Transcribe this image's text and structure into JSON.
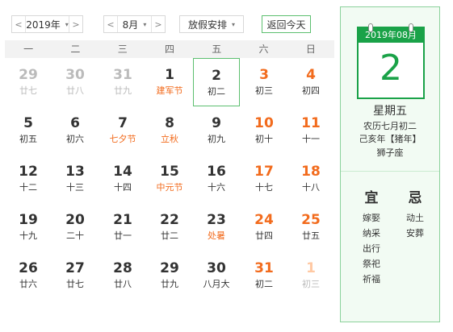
{
  "toolbar": {
    "year": "2019年",
    "month": "8月",
    "holiday": "放假安排",
    "today_button": "返回今天",
    "prev_symbol": "<",
    "next_symbol": ">",
    "dropdown_symbol": "▾"
  },
  "weekdays": [
    "一",
    "二",
    "三",
    "四",
    "五",
    "六",
    "日"
  ],
  "weeks": [
    [
      {
        "day": "29",
        "lunar": "廿七",
        "other": true
      },
      {
        "day": "30",
        "lunar": "廿八",
        "other": true
      },
      {
        "day": "31",
        "lunar": "廿九",
        "other": true
      },
      {
        "day": "1",
        "lunar": "建军节",
        "festival": true
      },
      {
        "day": "2",
        "lunar": "初二",
        "selected": true
      },
      {
        "day": "3",
        "lunar": "初三"
      },
      {
        "day": "4",
        "lunar": "初四"
      }
    ],
    [
      {
        "day": "5",
        "lunar": "初五"
      },
      {
        "day": "6",
        "lunar": "初六"
      },
      {
        "day": "7",
        "lunar": "七夕节",
        "festival": true
      },
      {
        "day": "8",
        "lunar": "立秋",
        "festival": true
      },
      {
        "day": "9",
        "lunar": "初九"
      },
      {
        "day": "10",
        "lunar": "初十"
      },
      {
        "day": "11",
        "lunar": "十一"
      }
    ],
    [
      {
        "day": "12",
        "lunar": "十二"
      },
      {
        "day": "13",
        "lunar": "十三"
      },
      {
        "day": "14",
        "lunar": "十四"
      },
      {
        "day": "15",
        "lunar": "中元节",
        "festival": true
      },
      {
        "day": "16",
        "lunar": "十六"
      },
      {
        "day": "17",
        "lunar": "十七"
      },
      {
        "day": "18",
        "lunar": "十八"
      }
    ],
    [
      {
        "day": "19",
        "lunar": "十九"
      },
      {
        "day": "20",
        "lunar": "二十"
      },
      {
        "day": "21",
        "lunar": "廿一"
      },
      {
        "day": "22",
        "lunar": "廿二"
      },
      {
        "day": "23",
        "lunar": "处暑",
        "festival": true
      },
      {
        "day": "24",
        "lunar": "廿四"
      },
      {
        "day": "25",
        "lunar": "廿五"
      }
    ],
    [
      {
        "day": "26",
        "lunar": "廿六"
      },
      {
        "day": "27",
        "lunar": "廿七"
      },
      {
        "day": "28",
        "lunar": "廿八"
      },
      {
        "day": "29",
        "lunar": "廿九"
      },
      {
        "day": "30",
        "lunar": "八月大"
      },
      {
        "day": "31",
        "lunar": "初二"
      },
      {
        "day": "1",
        "lunar": "初三",
        "other": true
      }
    ]
  ],
  "side": {
    "card_header": "2019年08月",
    "day": "2",
    "weekday": "星期五",
    "lunar_date": "农历七月初二",
    "ganzhi": "己亥年【猪年】",
    "zodiac_sign": "狮子座",
    "yi_title": "宜",
    "ji_title": "忌",
    "yi": [
      "嫁娶",
      "纳采",
      "出行",
      "祭祀",
      "祈福"
    ],
    "ji": [
      "动土",
      "安葬"
    ]
  },
  "colors": {
    "accent_green": "#1aa248",
    "weekend_orange": "#f26b1d",
    "muted": "#bbbbbb"
  }
}
